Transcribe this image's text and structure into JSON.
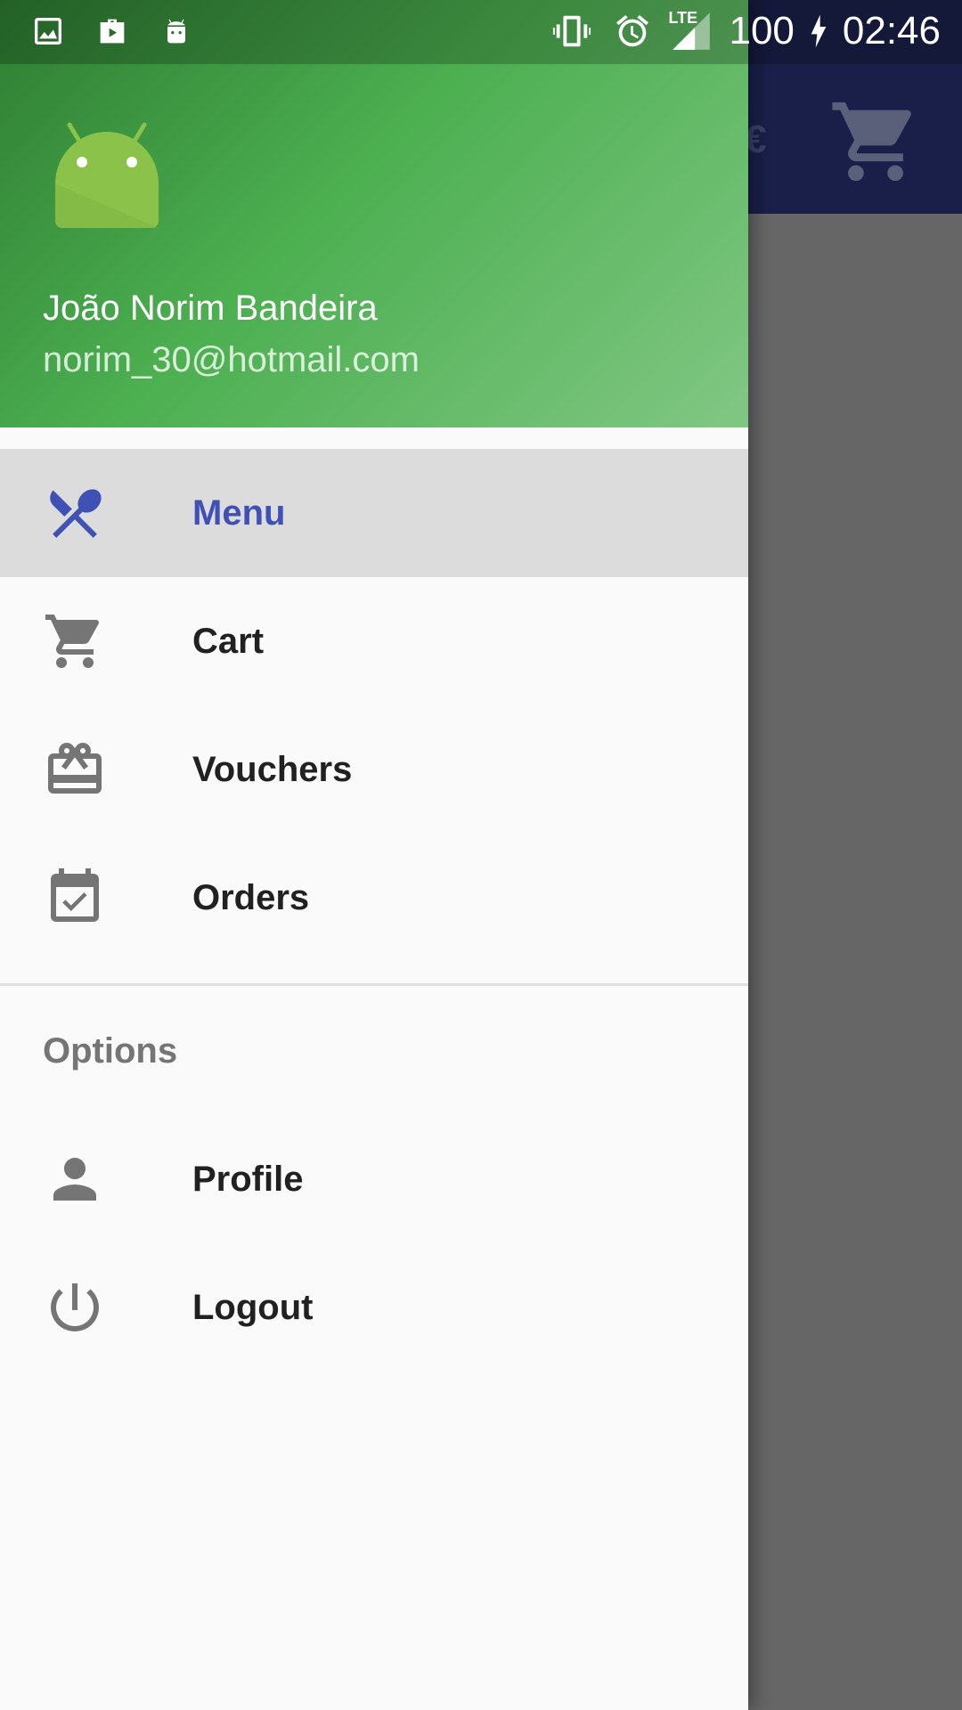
{
  "status_bar": {
    "battery": "100",
    "time": "02:46",
    "network": "LTE"
  },
  "background": {
    "currency_symbol": "€"
  },
  "drawer": {
    "user": {
      "name": "João Norim Bandeira",
      "email": "norim_30@hotmail.com"
    },
    "items": [
      {
        "label": "Menu",
        "icon": "restaurant-icon",
        "active": true
      },
      {
        "label": "Cart",
        "icon": "cart-icon",
        "active": false
      },
      {
        "label": "Vouchers",
        "icon": "voucher-icon",
        "active": false
      },
      {
        "label": "Orders",
        "icon": "calendar-check-icon",
        "active": false
      }
    ],
    "options_header": "Options",
    "options": [
      {
        "label": "Profile",
        "icon": "person-icon"
      },
      {
        "label": "Logout",
        "icon": "power-icon"
      }
    ]
  },
  "colors": {
    "header_green": "#4caf50",
    "active_blue": "#3f51b5",
    "app_bar": "#1a1f4a",
    "scrim": "#666666"
  }
}
